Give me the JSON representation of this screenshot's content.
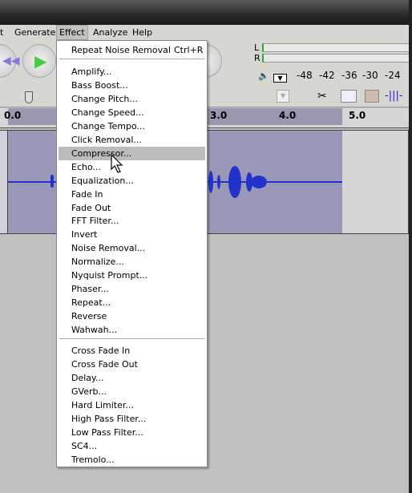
{
  "menubar": {
    "items": [
      "t",
      "Generate",
      "Effect",
      "Analyze",
      "Help"
    ],
    "active": "Effect"
  },
  "meter": {
    "left_label": "L",
    "right_label": "R",
    "scale": [
      "-48",
      "-42",
      "-36",
      "-30",
      "-24"
    ]
  },
  "ruler": {
    "labels": [
      "0.0",
      "3.0",
      "4.0",
      "5.0"
    ]
  },
  "effect_menu": {
    "repeat": {
      "label": "Repeat Noise Removal",
      "shortcut": "Ctrl+R"
    },
    "group1": [
      "Amplify...",
      "Bass Boost...",
      "Change Pitch...",
      "Change Speed...",
      "Change Tempo...",
      "Click Removal...",
      "Compressor...",
      "Echo...",
      "Equalization...",
      "Fade In",
      "Fade Out",
      "FFT Filter...",
      "Invert",
      "Noise Removal...",
      "Normalize...",
      "Nyquist Prompt...",
      "Phaser...",
      "Repeat...",
      "Reverse",
      "Wahwah..."
    ],
    "group2": [
      "Cross Fade In",
      "Cross Fade Out",
      "Delay...",
      "GVerb...",
      "Hard Limiter...",
      "High Pass Filter...",
      "Low Pass Filter...",
      "SC4...",
      "Tremolo..."
    ],
    "highlighted": "Compressor..."
  },
  "colors": {
    "selection": "#9a98b8",
    "waveform": "#2233cc",
    "highlight": "#bcbcbc"
  }
}
